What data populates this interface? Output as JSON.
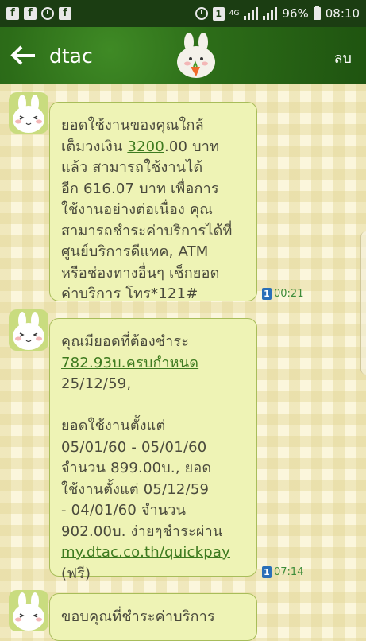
{
  "status_bar": {
    "sim_slot": "1",
    "network": "4G",
    "battery": "96%",
    "time": "08:10",
    "icons": [
      "facebook-icon",
      "facebook-icon",
      "alarm-icon",
      "facebook-icon"
    ]
  },
  "header": {
    "title": "dtac",
    "delete_label": "ลบ"
  },
  "messages": [
    {
      "lines_before": "ยอดใช้งานของคุณใกล้\nเต็มวงเงิน ",
      "link": "3200",
      "lines_after": ".00 บาท\nแล้ว สามารถใช้งานได้\nอีก 616.07 บาท เพื่อการ\nใช้งานอย่างต่อเนื่อง คุณ\nสามารถชำระค่าบริการได้ที่\nศูนย์บริการดีแทค, ATM\nหรือช่องทางอื่นๆ เช็กยอด\nค่าบริการ โทร*121#",
      "sim": "1",
      "time": "00:21"
    },
    {
      "line1": "คุณมียอดที่ต้องชำระ",
      "link": "782.93บ.ครบกำหนด",
      "lines_mid": "25/12/59,\n\nยอดใช้งานตั้งแต่\n05/01/60 - 05/01/60\nจำนวน 899.00บ., ยอด\nใช้งานตั้งแต่ 05/12/59\n- 04/01/60 จำนวน\n902.00บ. ง่ายๆชำระผ่าน",
      "link2": "my.dtac.co.th/quickpay",
      "line_end": "(ฟรี)",
      "sim": "1",
      "time": "07:14"
    },
    {
      "text": "ขอบคุณที่ชำระค่าบริการ"
    }
  ],
  "colors": {
    "header_green": "#2c6c18",
    "bubble_fill": "#eef3b5",
    "bubble_border": "#a8bd5a",
    "link_green": "#3d7a1f",
    "time_green": "#3e8c3a"
  }
}
